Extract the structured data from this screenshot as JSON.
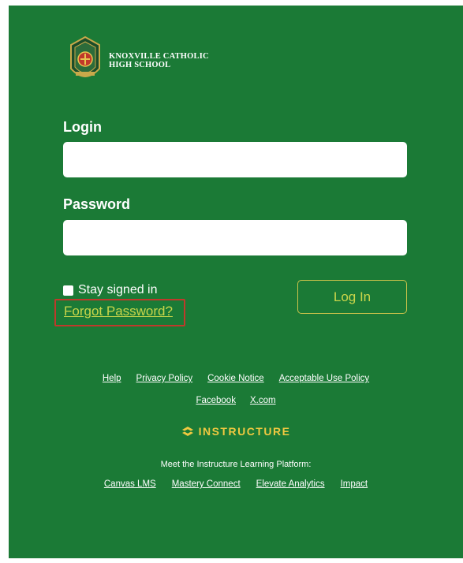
{
  "school": {
    "name_line1": "KNOXVILLE CATHOLIC",
    "name_line2": "HIGH SCHOOL"
  },
  "form": {
    "login_label": "Login",
    "login_value": "",
    "password_label": "Password",
    "password_value": "",
    "stay_signed_in_label": "Stay signed in",
    "stay_signed_in_checked": false,
    "forgot_password_label": "Forgot Password?",
    "login_button_label": "Log In"
  },
  "footer": {
    "links_row1": [
      "Help",
      "Privacy Policy",
      "Cookie Notice",
      "Acceptable Use Policy"
    ],
    "links_row2": [
      "Facebook",
      "X.com"
    ],
    "brand": "INSTRUCTURE",
    "tagline": "Meet the Instructure Learning Platform:",
    "platform_links": [
      "Canvas LMS",
      "Mastery Connect",
      "Elevate Analytics",
      "Impact"
    ]
  },
  "colors": {
    "background": "#1b7a36",
    "link_accent": "#c9d54a",
    "brand_accent": "#f0c940",
    "highlight_box": "#c0392b"
  }
}
